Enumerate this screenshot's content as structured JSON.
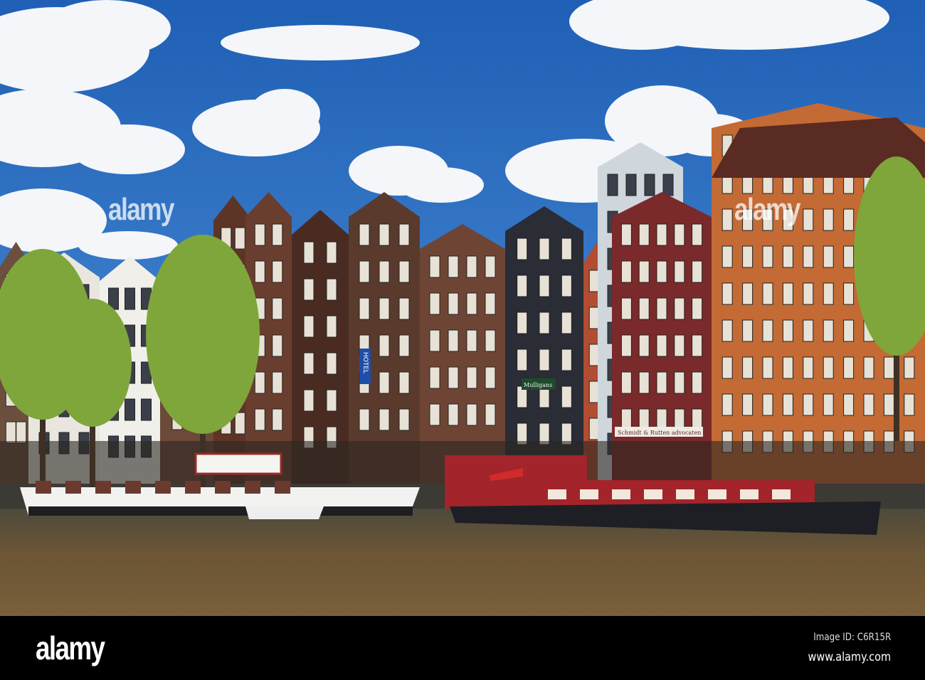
{
  "photo": {
    "subject": "Amsterdam canal houses with houseboats",
    "signs": {
      "hotel": "HOTEL",
      "pub": "Mulligans",
      "law_office": "Schmidt & Rutten advocaten"
    },
    "colors": {
      "sky_top": "#1f5fb5",
      "sky_bottom": "#4b8fd6",
      "water": "#6b5536",
      "brick_orange": "#c46a34",
      "brick_dark": "#5a3a2c",
      "boat_red": "#a3242a"
    }
  },
  "watermark": {
    "overlay_text": "alamy",
    "dot_text": "a"
  },
  "footer": {
    "logo": "alamy",
    "image_id": "Image ID: C6R15R",
    "website": "www.alamy.com"
  }
}
